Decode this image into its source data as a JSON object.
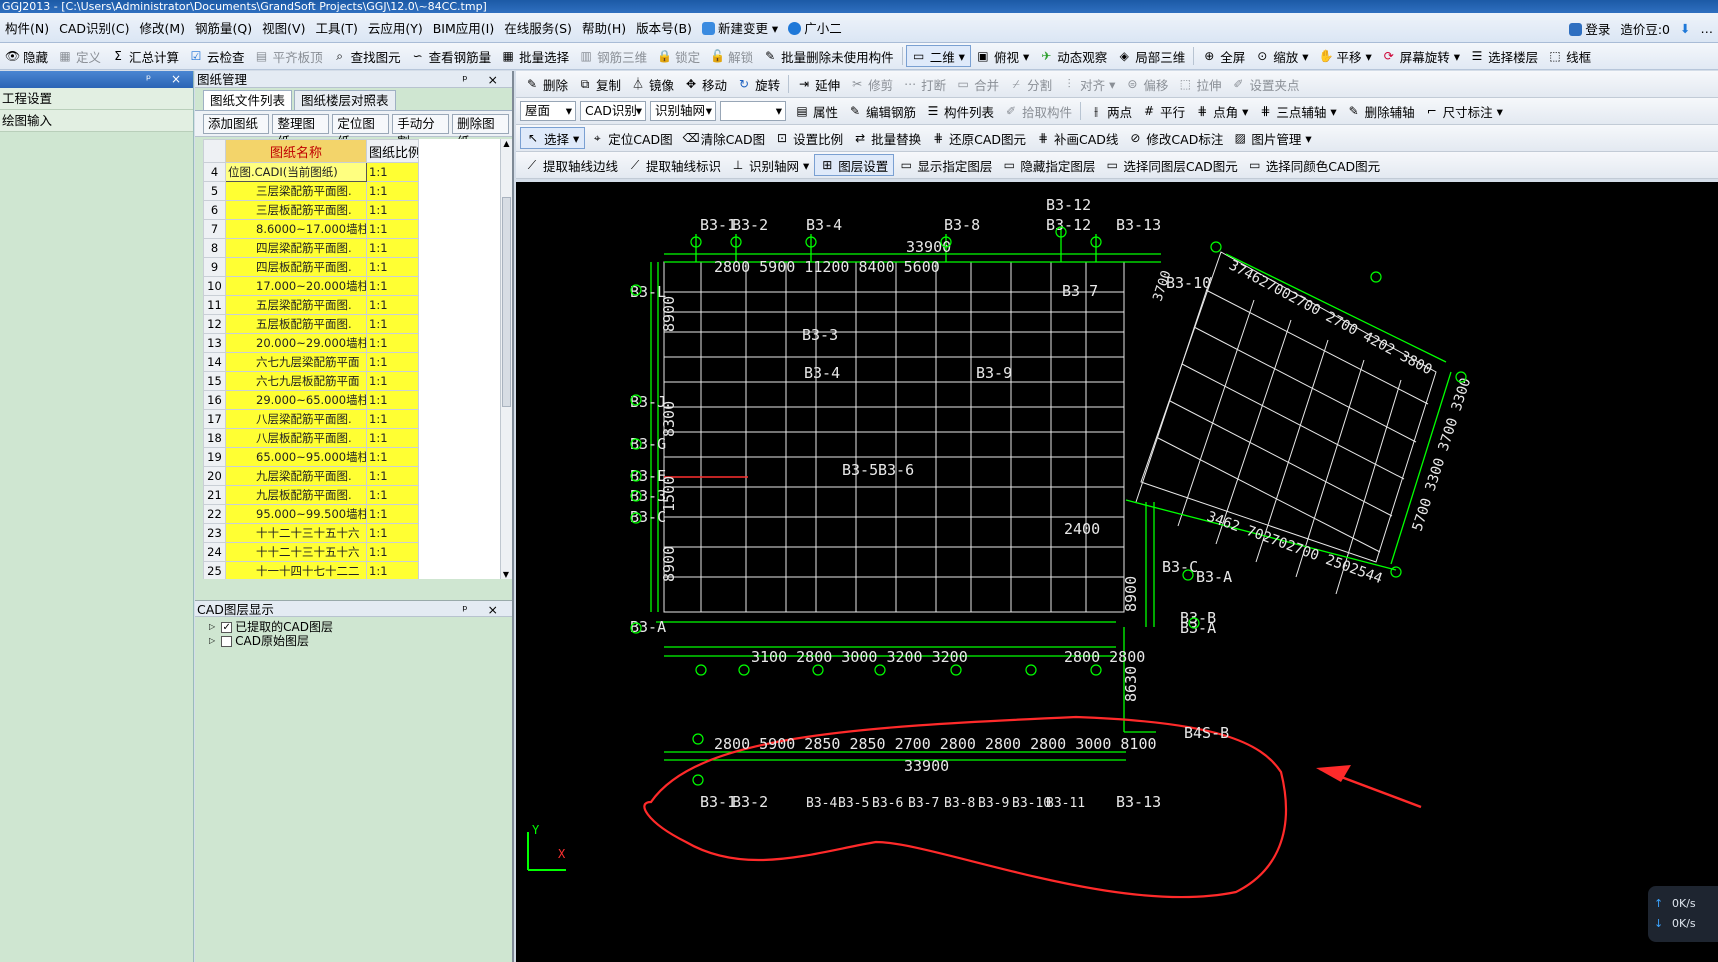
{
  "window": {
    "title": "GGJ2013 - [C:\\Users\\Administrator\\Documents\\GrandSoft Projects\\GGJ\\12.0\\~84CC.tmp]"
  },
  "menu": {
    "items": [
      "构件(N)",
      "CAD识别(C)",
      "修改(M)",
      "钢筋量(Q)",
      "视图(V)",
      "工具(T)",
      "云应用(Y)",
      "BIM应用(I)",
      "在线服务(S)",
      "帮助(H)",
      "版本号(B)"
    ],
    "new_change": "新建变更",
    "helper": "广小二",
    "login": "登录",
    "price": "造价豆:0"
  },
  "toolbar1": {
    "items": [
      "隐藏",
      "定义",
      "汇总计算",
      "云检查",
      "平齐板顶",
      "查找图元",
      "查看钢筋量",
      "批量选择",
      "钢筋三维",
      "锁定",
      "解锁",
      "批量删除未使用构件",
      "二维",
      "俯视",
      "动态观察",
      "局部三维",
      "全屏",
      "缩放",
      "平移",
      "屏幕旋转",
      "选择楼层",
      "线框"
    ]
  },
  "left_panel": {
    "items": [
      "工程设置",
      "绘图输入"
    ]
  },
  "drawing_panel": {
    "title": "图纸管理",
    "tabs": [
      "图纸文件列表",
      "图纸楼层对照表"
    ],
    "buttons": [
      "添加图纸",
      "整理图纸",
      "定位图纸",
      "手动分割",
      "删除图纸"
    ],
    "columns": [
      "图纸名称",
      "图纸比例"
    ],
    "rows": [
      {
        "n": "4",
        "name": "位图.CADI(当前图纸)",
        "scale": "1:1"
      },
      {
        "n": "5",
        "name": "三层梁配筋平面图.",
        "scale": "1:1"
      },
      {
        "n": "6",
        "name": "三层板配筋平面图.",
        "scale": "1:1"
      },
      {
        "n": "7",
        "name": "8.6000~17.000墙柱平",
        "scale": "1:1"
      },
      {
        "n": "8",
        "name": "四层梁配筋平面图.",
        "scale": "1:1"
      },
      {
        "n": "9",
        "name": "四层板配筋平面图.",
        "scale": "1:1"
      },
      {
        "n": "10",
        "name": "17.000~20.000墙柱平",
        "scale": "1:1"
      },
      {
        "n": "11",
        "name": "五层梁配筋平面图.",
        "scale": "1:1"
      },
      {
        "n": "12",
        "name": "五层板配筋平面图.",
        "scale": "1:1"
      },
      {
        "n": "13",
        "name": "20.000~29.000墙柱平",
        "scale": "1:1"
      },
      {
        "n": "14",
        "name": "六七九层梁配筋平面",
        "scale": "1:1"
      },
      {
        "n": "15",
        "name": "六七九层板配筋平面",
        "scale": "1:1"
      },
      {
        "n": "16",
        "name": "29.000~65.000墙柱平",
        "scale": "1:1"
      },
      {
        "n": "17",
        "name": "八层梁配筋平面图.",
        "scale": "1:1"
      },
      {
        "n": "18",
        "name": "八层板配筋平面图.",
        "scale": "1:1"
      },
      {
        "n": "19",
        "name": "65.000~95.000墙柱平",
        "scale": "1:1"
      },
      {
        "n": "20",
        "name": "九层梁配筋平面图.",
        "scale": "1:1"
      },
      {
        "n": "21",
        "name": "九层板配筋平面图.",
        "scale": "1:1"
      },
      {
        "n": "22",
        "name": "95.000~99.500墙柱平",
        "scale": "1:1"
      },
      {
        "n": "23",
        "name": "十十二十三十五十六",
        "scale": "1:1"
      },
      {
        "n": "24",
        "name": "十十二十三十五十六",
        "scale": "1:1"
      },
      {
        "n": "25",
        "name": "十一十四十七十二二",
        "scale": "1:1"
      }
    ]
  },
  "layer_panel": {
    "title": "CAD图层显示",
    "items": [
      "已提取的CAD图层",
      "CAD原始图层"
    ]
  },
  "cad_toolbar": {
    "row1": [
      "删除",
      "复制",
      "镜像",
      "移动",
      "旋转",
      "延伸",
      "修剪",
      "打断",
      "合并",
      "分割",
      "对齐",
      "偏移",
      "拉伸",
      "设置夹点"
    ],
    "floor": "屋面",
    "cad_recog": "CAD识别",
    "axis_recog": "识别轴网",
    "row2": [
      "属性",
      "编辑钢筋",
      "构件列表",
      "拾取构件",
      "两点",
      "平行",
      "点角",
      "三点辅轴",
      "删除辅轴",
      "尺寸标注"
    ],
    "row3": [
      "选择",
      "定位CAD图",
      "清除CAD图",
      "设置比例",
      "批量替换",
      "还原CAD图元",
      "补画CAD线",
      "修改CAD标注",
      "图片管理"
    ],
    "row4": [
      "提取轴线边线",
      "提取轴线标识",
      "识别轴网",
      "图层设置",
      "显示指定图层",
      "隐藏指定图层",
      "选择同图层CAD图元",
      "选择同颜色CAD图元"
    ]
  },
  "cad": {
    "top_axis": [
      "B3-1",
      "B3-2",
      "B3-4",
      "B3-8",
      "B3-12",
      "B3-12",
      "B3-13"
    ],
    "top_dims": "2800 5900  11200  8400  5600",
    "top_total": "33900",
    "right_axis": "B3-10",
    "axis_b37": "B3 7",
    "left_axis": [
      "B3-L",
      "B3-J",
      "B3-G",
      "B3-E",
      "B3-3",
      "B3-C",
      "B3-A"
    ],
    "inner_labels": [
      "B3-3",
      "B3-4",
      "B3-9",
      "B3-5",
      "B3-6"
    ],
    "left_dims": [
      "8900",
      "8300",
      "1500",
      "8900"
    ],
    "right_dims": [
      "2400",
      "8900",
      "8630"
    ],
    "right_axis_c": "B3-C",
    "right_axis_a": "B3-A",
    "right_axis_b": "B3-B",
    "right_axis_a2": "B3-A",
    "rot_top": "374627002700 2700 4202 3800",
    "rot_right": "5700 3300 3700 3300",
    "rot_bottom": "3462 702702700 2502544",
    "rot_left": "3700",
    "bottom_dims": "3100 2800 3000 3200 3200",
    "bottom_dims_right": "2800 2800",
    "lower_dims": "2800  5900  2850 2850 2700 2800 2800 2800 3000  8100",
    "lower_total": "33900",
    "lower_axis": [
      "B3-1",
      "B3-2",
      "B3-4",
      "B3-5",
      "B3-6",
      "B3-7",
      "B3-8",
      "B3-9",
      "B3-10",
      "B3-11",
      "B3-13"
    ],
    "b4s": "B4S-B",
    "ucs_y": "Y",
    "ucs_x": "X"
  },
  "speed": {
    "up": "0K/s",
    "down": "0K/s"
  },
  "colors": {
    "cad_green": "#00ff00",
    "cad_white": "#e8e8e8",
    "annotation_red": "#ff2a2a",
    "sheet_yellow": "#ffff33"
  }
}
